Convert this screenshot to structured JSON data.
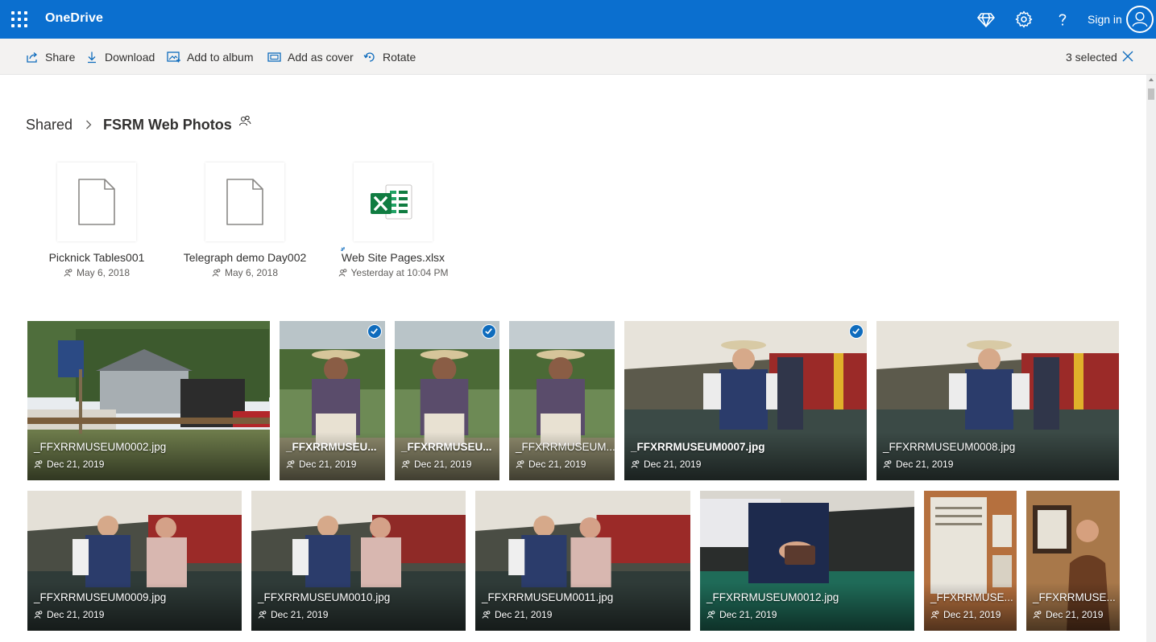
{
  "app": {
    "title": "OneDrive",
    "signin_label": "Sign in",
    "accent": "#0b6fcf"
  },
  "icons": [
    "app-launcher-icon",
    "premium-diamond-icon",
    "settings-gear-icon",
    "help-icon",
    "user-avatar-icon"
  ],
  "toolbar": {
    "share": "Share",
    "download": "Download",
    "add_to_album": "Add to album",
    "add_as_cover": "Add as cover",
    "rotate": "Rotate",
    "selected_count": "3 selected"
  },
  "breadcrumb": {
    "root": "Shared",
    "current": "FSRM Web Photos"
  },
  "files": [
    {
      "name": "Picknick Tables001",
      "date": "May 6, 2018",
      "kind": "generic"
    },
    {
      "name": "Telegraph demo Day002",
      "date": "May 6, 2018",
      "kind": "generic"
    },
    {
      "name": "Web Site Pages.xlsx",
      "date": "Yesterday at 10:04 PM",
      "kind": "excel"
    }
  ],
  "photos": [
    {
      "name": "_FFXRRMUSEUM0002.jpg",
      "date": "Dec 21, 2019",
      "selected": false
    },
    {
      "name": "_FFXRRMUSEU...",
      "date": "Dec 21, 2019",
      "selected": true
    },
    {
      "name": "_FFXRRMUSEU...",
      "date": "Dec 21, 2019",
      "selected": true
    },
    {
      "name": "_FFXRRMUSEUM...",
      "date": "Dec 21, 2019",
      "selected": false
    },
    {
      "name": "_FFXRRMUSEUM0007.jpg",
      "date": "Dec 21, 2019",
      "selected": true
    },
    {
      "name": "_FFXRRMUSEUM0008.jpg",
      "date": "Dec 21, 2019",
      "selected": false
    },
    {
      "name": "_FFXRRMUSEUM0009.jpg",
      "date": "Dec 21, 2019",
      "selected": false
    },
    {
      "name": "_FFXRRMUSEUM0010.jpg",
      "date": "Dec 21, 2019",
      "selected": false
    },
    {
      "name": "_FFXRRMUSEUM0011.jpg",
      "date": "Dec 21, 2019",
      "selected": false
    },
    {
      "name": "_FFXRRMUSEUM0012.jpg",
      "date": "Dec 21, 2019",
      "selected": false
    },
    {
      "name": "_FFXRRMUSE...",
      "date": "Dec 21, 2019",
      "selected": false
    },
    {
      "name": "_FFXRRMUSE...",
      "date": "Dec 21, 2019",
      "selected": false
    }
  ]
}
